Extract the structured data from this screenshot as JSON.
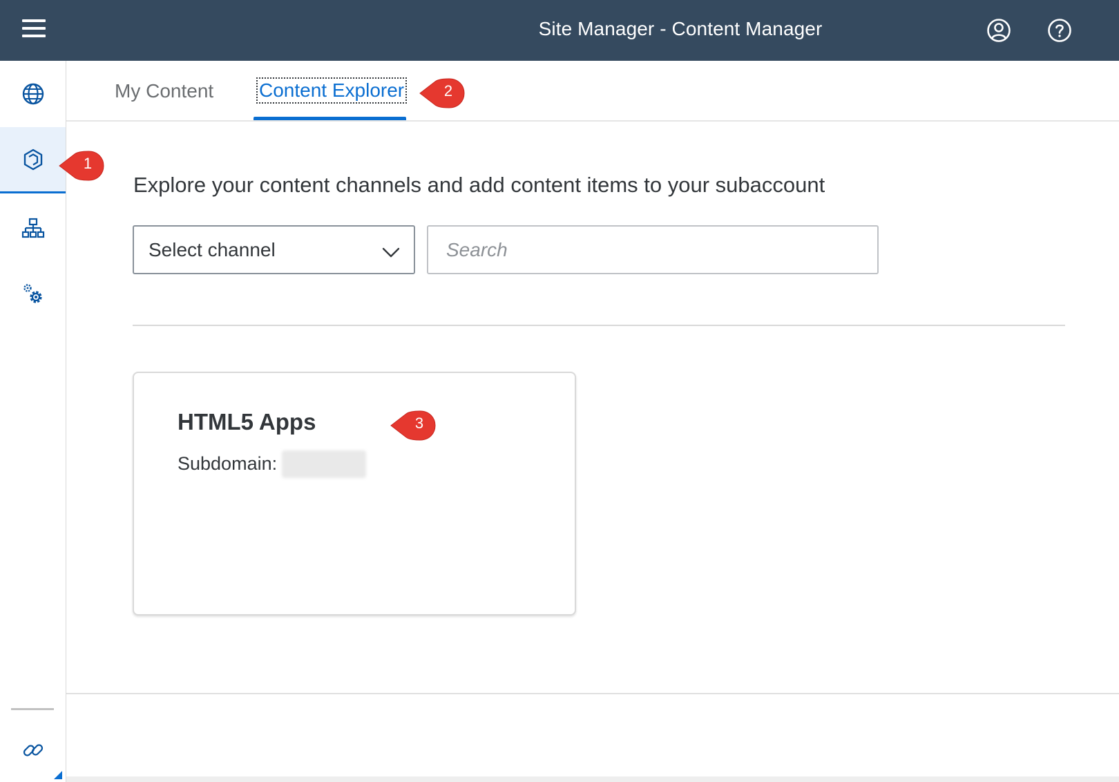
{
  "shell": {
    "title": "Site Manager - Content Manager",
    "menu_icon": "hamburger-menu-icon",
    "user_icon": "user-icon",
    "help_icon": "help-icon",
    "background_color": "#354a5f"
  },
  "sidenav": {
    "items": [
      {
        "icon": "globe-icon",
        "selected": false
      },
      {
        "icon": "content-manager-icon",
        "selected": true
      },
      {
        "icon": "hierarchy-icon",
        "selected": false
      },
      {
        "icon": "settings-icon",
        "selected": false
      }
    ],
    "bottom_icon": "link-icon"
  },
  "tabs": {
    "items": [
      {
        "label": "My Content",
        "active": false
      },
      {
        "label": "Content Explorer",
        "active": true
      }
    ],
    "accent_color": "#0a6ed1"
  },
  "page": {
    "description": "Explore your content channels and add content items to your subaccount"
  },
  "filters": {
    "channel_select_value": "Select channel",
    "search_placeholder": "Search"
  },
  "cards": [
    {
      "title": "HTML5 Apps",
      "subdomain_label": "Subdomain:"
    }
  ],
  "callouts": [
    {
      "number": "1"
    },
    {
      "number": "2"
    },
    {
      "number": "3"
    }
  ],
  "callout_color": "#e5382f"
}
